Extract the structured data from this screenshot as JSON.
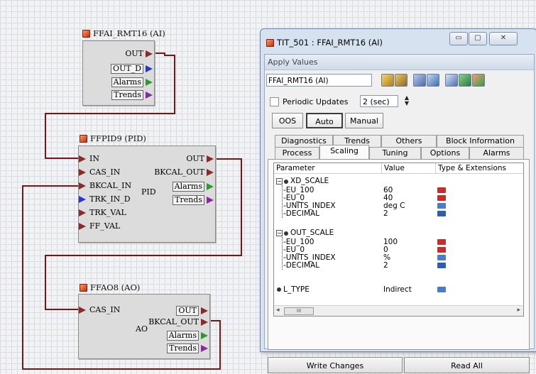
{
  "canvas": {
    "blocks": [
      {
        "id": "ai",
        "title": "FFAI_RMT16 (AI)",
        "outputs": [
          "OUT",
          "OUT_D",
          "Alarms",
          "Trends"
        ]
      },
      {
        "id": "pid",
        "title": "FFPID9 (PID)",
        "center_label": "PID",
        "inputs": [
          "IN",
          "CAS_IN",
          "BKCAL_IN",
          "TRK_IN_D",
          "TRK_VAL",
          "FF_VAL"
        ],
        "outputs": [
          "OUT",
          "BKCAL_OUT",
          "Alarms",
          "Trends"
        ]
      },
      {
        "id": "ao",
        "title": "FFAO8 (AO)",
        "center_label": "AO",
        "inputs": [
          "CAS_IN"
        ],
        "outputs": [
          "OUT",
          "BKCAL_OUT",
          "Alarms",
          "Trends"
        ]
      }
    ],
    "wire_color": "#7a1515"
  },
  "dialog": {
    "title": "TIT_501 : FFAI_RMT16 (AI)",
    "window_buttons": {
      "minimize": "▭",
      "maximize": "▢",
      "close": "✕"
    },
    "menu": "Apply Values",
    "block_select": "FFAI_RMT16 (AI)",
    "toolbar_icons": [
      "apply-icon",
      "refresh-icon",
      "compare-icon",
      "chart-icon",
      "save-icon",
      "print-icon",
      "options-icon"
    ],
    "periodic_updates": {
      "label": "Periodic Updates",
      "checked": false,
      "interval": "2 (sec)"
    },
    "mode_buttons": [
      "OOS",
      "Auto",
      "Manual"
    ],
    "selected_mode": "Auto",
    "tabs_back": [
      "Diagnostics",
      "Trends",
      "Others",
      "Block Information"
    ],
    "tabs_front": [
      "Process",
      "Scaling",
      "Tuning",
      "Options",
      "Alarms"
    ],
    "active_tab": "Scaling",
    "columns": [
      "Parameter",
      "Value",
      "Type & Extensions"
    ],
    "groups": [
      {
        "name": "XD_SCALE",
        "rows": [
          {
            "param": "EU_100",
            "value": "60",
            "type": "red"
          },
          {
            "param": "EU_0",
            "value": "40",
            "type": "red"
          },
          {
            "param": "UNITS_INDEX",
            "value": "deg C",
            "type": "blue"
          },
          {
            "param": "DECIMAL",
            "value": "2",
            "type": "darkblue"
          }
        ]
      },
      {
        "name": "OUT_SCALE",
        "rows": [
          {
            "param": "EU_100",
            "value": "100",
            "type": "red"
          },
          {
            "param": "EU_0",
            "value": "0",
            "type": "red"
          },
          {
            "param": "UNITS_INDEX",
            "value": "%",
            "type": "blue"
          },
          {
            "param": "DECIMAL",
            "value": "2",
            "type": "darkblue"
          }
        ]
      }
    ],
    "single": {
      "name": "L_TYPE",
      "value": "Indirect",
      "type": "blue"
    },
    "scroll_thumb": "III",
    "write_button": "Write Changes",
    "read_button": "Read All"
  }
}
